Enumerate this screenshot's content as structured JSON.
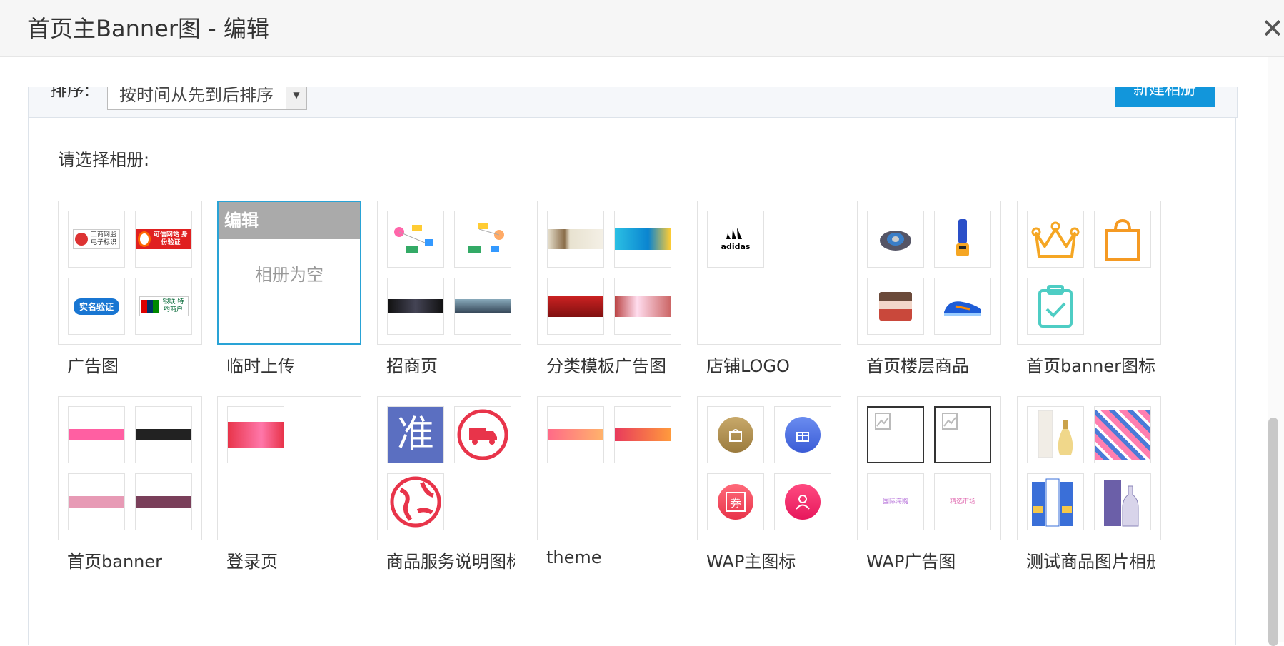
{
  "dialog": {
    "title": "首页主Banner图 - 编辑",
    "close_glyph": "✕"
  },
  "toolbar": {
    "sort_label": "排序:",
    "sort_value": "按时间从先到后排序",
    "new_album": "新建相册"
  },
  "prompt": "请选择相册:",
  "colors": {
    "accent": "#1296db",
    "selected_border": "#29a3d6"
  },
  "albums": [
    {
      "name": "广告图",
      "thumbs": [
        "工商网监 电子标识",
        "可信网站 身份验证",
        "实名验证",
        "银联 特约商户"
      ]
    },
    {
      "name": "临时上传",
      "edit_label": "编辑",
      "empty_text": "相册为空"
    },
    {
      "name": "招商页"
    },
    {
      "name": "分类模板广告图"
    },
    {
      "name": "店铺LOGO",
      "thumbs": [
        "adidas"
      ]
    },
    {
      "name": "首页楼层商品"
    },
    {
      "name": "首页banner图标"
    },
    {
      "name": "首页banner"
    },
    {
      "name": "登录页"
    },
    {
      "name": "商品服务说明图标",
      "thumbs": [
        "准"
      ]
    },
    {
      "name": "theme"
    },
    {
      "name": "WAP主图标",
      "thumbs": [
        "",
        "",
        "券",
        ""
      ]
    },
    {
      "name": "WAP广告图",
      "thumbs": [
        "",
        "",
        "国际海购",
        "精选市场"
      ]
    },
    {
      "name": "测试商品图片相册"
    }
  ]
}
